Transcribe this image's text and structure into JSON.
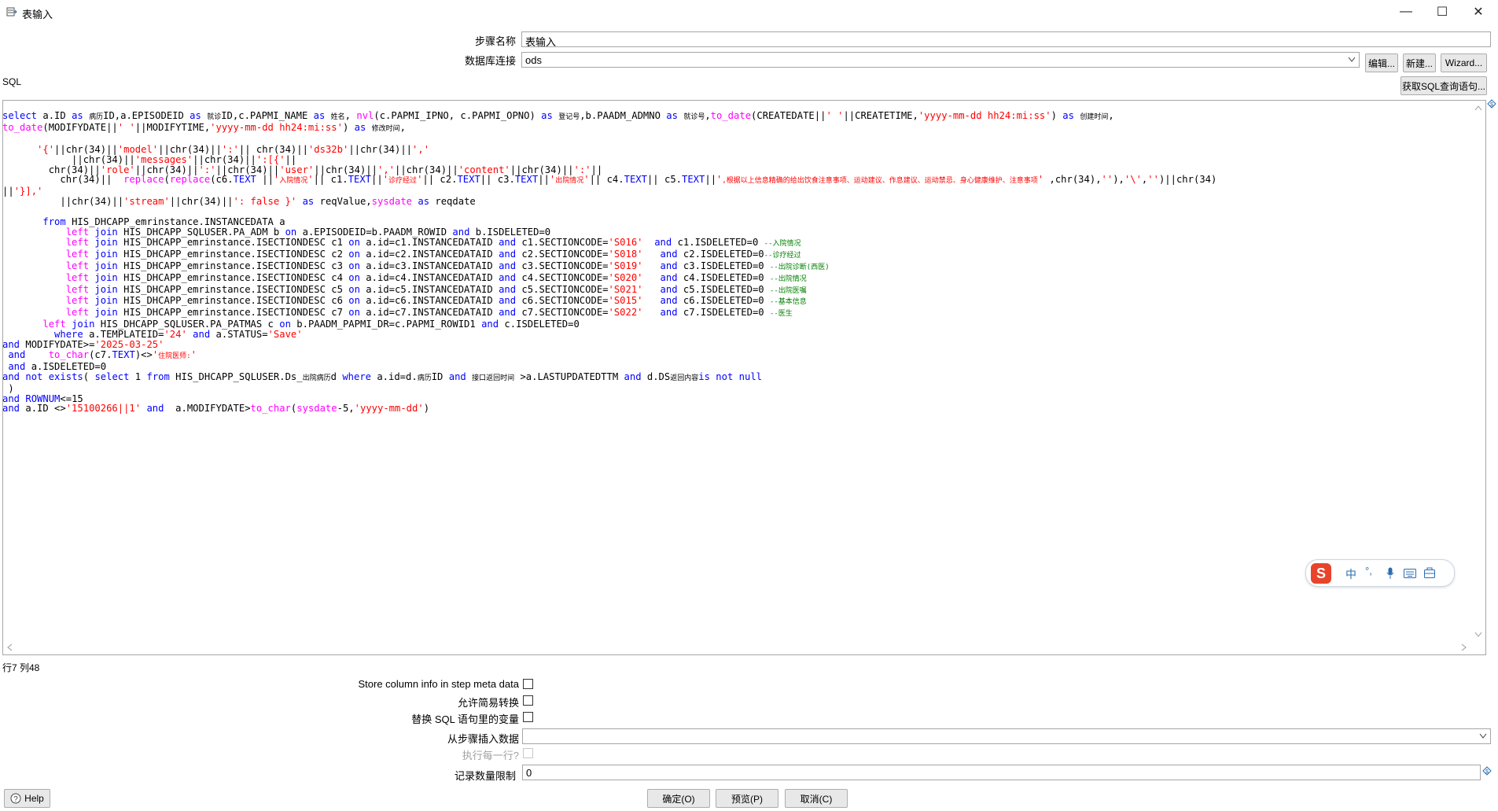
{
  "window": {
    "title": "表输入",
    "minimize": "—",
    "maximize": "☐",
    "close": "✕"
  },
  "form": {
    "step_name_label": "步骤名称",
    "step_name_value": "表输入",
    "db_conn_label": "数据库连接",
    "db_conn_value": "ods",
    "edit_btn": "编辑...",
    "new_btn": "新建...",
    "wizard_btn": "Wizard...",
    "sql_label": "SQL",
    "get_sql_btn": "获取SQL查询语句..."
  },
  "status": {
    "position": "行7 列48"
  },
  "options": {
    "store_column_info": "Store column info in step meta data",
    "lazy_conversion": "允许简易转换",
    "replace_vars": "替换 SQL 语句里的变量",
    "insert_from_step": "从步骤插入数据",
    "execute_each_row": "执行每一行?",
    "limit_label": "记录数量限制",
    "limit_value": "0"
  },
  "footer": {
    "help": "Help",
    "ok": "确定(O)",
    "preview": "预览(P)",
    "cancel": "取消(C)"
  },
  "ime": {
    "chinese": "中",
    "punct": "°,"
  },
  "icons": {
    "app_icon": "table-input-icon",
    "dropdown": "chevron-down-icon",
    "variable": "diamond-variable-icon"
  }
}
